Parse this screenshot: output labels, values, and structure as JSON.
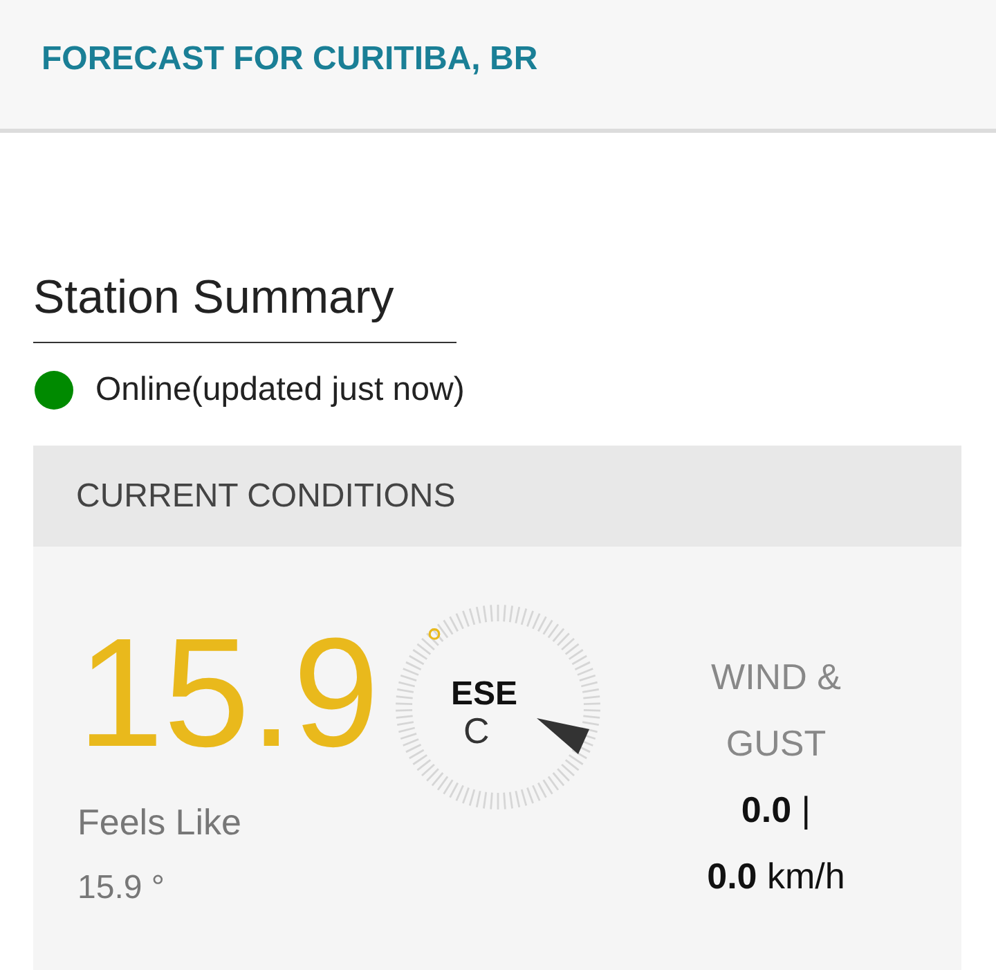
{
  "header": {
    "title": "FORECAST FOR CURITIBA, BR"
  },
  "station": {
    "heading": "Station Summary",
    "online": true,
    "status": "Online(updated just now)"
  },
  "current": {
    "heading": "CURRENT CONDITIONS",
    "temperature": "15.9",
    "degree": "°",
    "unit": "C",
    "direction": "ESE",
    "feels_like_label": "Feels Like",
    "feels_like": "15.9 °",
    "wind_label_lines": [
      "WIND &",
      "GUST"
    ],
    "wind": "**0.0** |",
    "gust": "**0.0** km/h"
  }
}
